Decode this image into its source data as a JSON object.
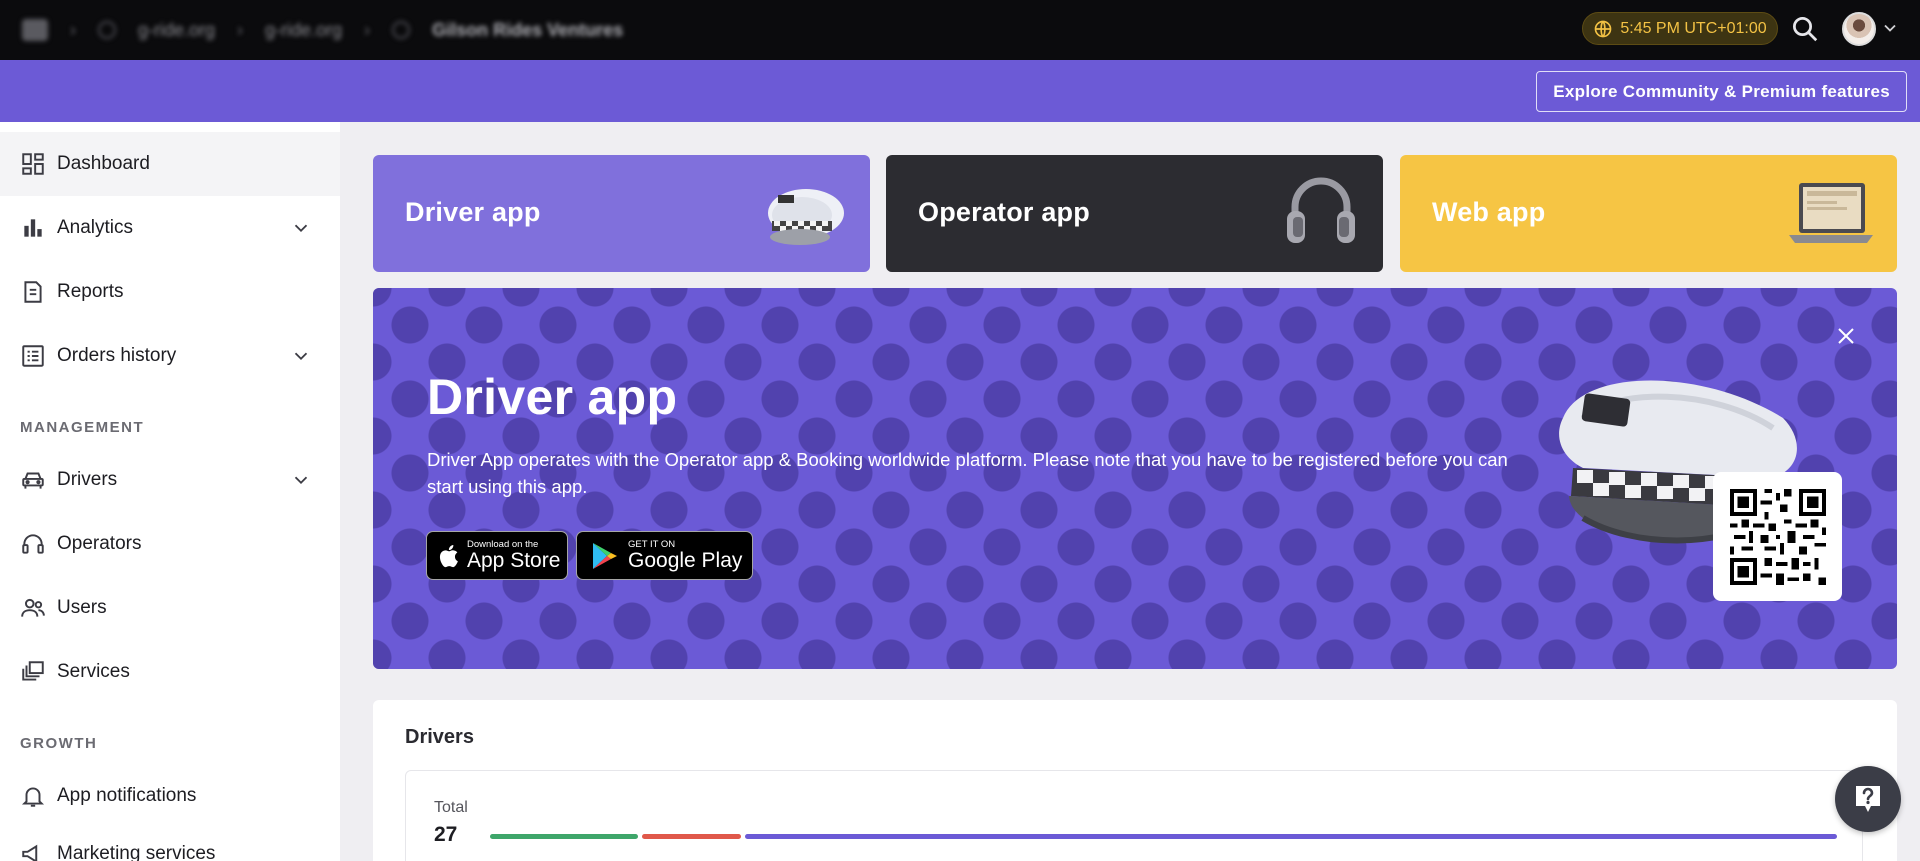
{
  "topbar": {
    "breadcrumb": [
      "g-ride.org",
      "g-ride.org",
      "Gilson Rides Ventures"
    ],
    "time": "5:45 PM UTC+01:00"
  },
  "header": {
    "explore_label": "Explore Community & Premium features"
  },
  "sidebar": {
    "items": [
      {
        "label": "Dashboard",
        "icon": "dashboard-icon"
      },
      {
        "label": "Analytics",
        "icon": "bar-chart-icon"
      },
      {
        "label": "Reports",
        "icon": "report-icon"
      },
      {
        "label": "Orders history",
        "icon": "list-icon"
      }
    ],
    "management_label": "MANAGEMENT",
    "management_items": [
      {
        "label": "Drivers",
        "icon": "car-icon"
      },
      {
        "label": "Operators",
        "icon": "headset-icon"
      },
      {
        "label": "Users",
        "icon": "users-icon"
      },
      {
        "label": "Services",
        "icon": "services-icon"
      }
    ],
    "growth_label": "GROWTH",
    "growth_items": [
      {
        "label": "App notifications",
        "icon": "bell-icon"
      },
      {
        "label": "Marketing services",
        "icon": "megaphone-icon"
      }
    ]
  },
  "apps": {
    "driver": "Driver app",
    "operator": "Operator app",
    "web": "Web app"
  },
  "banner": {
    "title": "Driver app",
    "description": "Driver App operates with the Operator app & Booking worldwide platform. Please note that you have to be registered before you can start using this app.",
    "appstore_small": "Download on the",
    "appstore_big": "App Store",
    "gplay_small": "GET IT ON",
    "gplay_big": "Google Play"
  },
  "drivers": {
    "title": "Drivers",
    "total_label": "Total",
    "total_value": "27",
    "bar_colors": [
      "#3ea66a",
      "#e0584a",
      "#6b5ad6"
    ]
  },
  "colors": {
    "brand_purple": "#6c5ad6",
    "web_yellow": "#f6c544",
    "operator_dark": "#2c2c31"
  }
}
